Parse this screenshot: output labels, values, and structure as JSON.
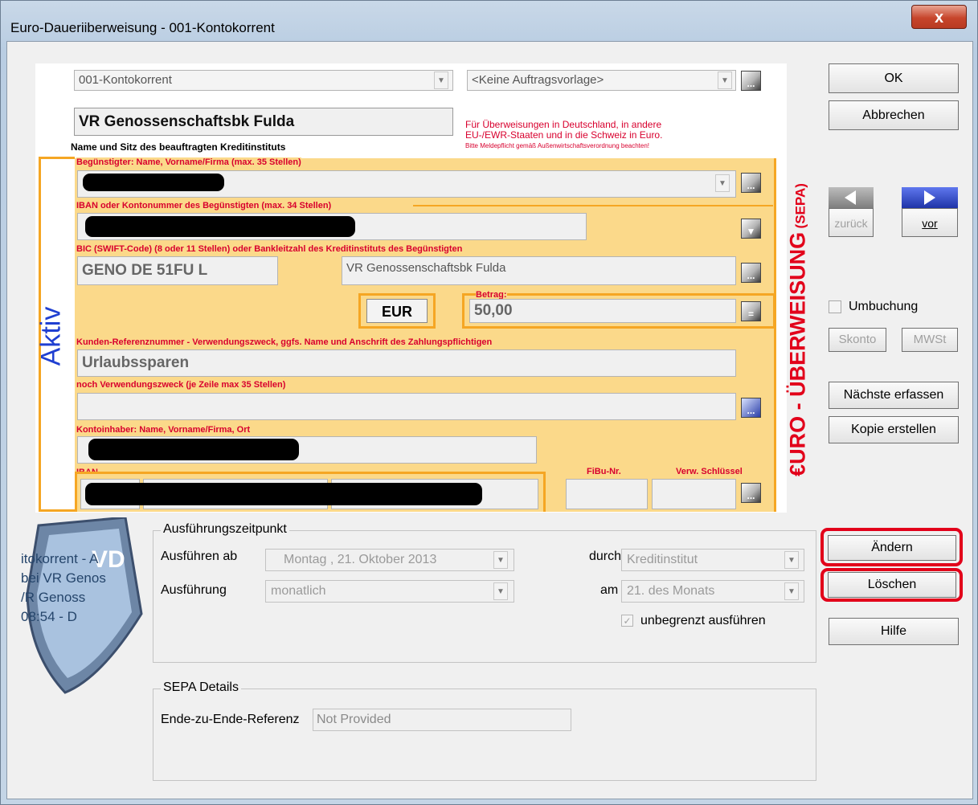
{
  "window": {
    "title": "Euro-Daueriiberweisung - 001-Kontokorrent",
    "close_label": "x"
  },
  "top": {
    "account_select": "001-Kontokorrent",
    "template_select": "<Keine Auftragsvorlage>",
    "bank_name": "VR Genossenschaftsbk Fulda",
    "bank_caption": "Name und Sitz des beauftragten Kreditinstituts",
    "notice_line1": "Für Überweisungen in Deutschland, in andere",
    "notice_line2": "EU-/EWR-Staaten und in die Schweiz in Euro.",
    "notice_line3": "Bitte Meldepflicht gemäß Außenwirtschaftsverordnung beachten!"
  },
  "form": {
    "beneficiary_label": "Begünstigter: Name, Vorname/Firma (max. 35 Stellen)",
    "iban_label": "IBAN oder Kontonummer des Begünstigten (max. 34 Stellen)",
    "bic_label": "BIC (SWIFT-Code) (8 oder 11 Stellen) oder Bankleitzahl des Kreditinstituts des Begünstigten",
    "bic_value": "GENO DE 51FU L",
    "bank_value": "VR Genossenschaftsbk Fulda",
    "amount_label": "Betrag:",
    "currency": "EUR",
    "amount": "50,00",
    "reference_label": "Kunden-Referenznummer - Verwendungszweck, ggfs. Name und Anschrift des Zahlungspflichtigen",
    "reference_value": "Urlaubssparen",
    "purpose2_label": "noch Verwendungszweck (je Zeile max 35 Stellen)",
    "purpose2_value": "",
    "holder_label": "Kontoinhaber: Name, Vorname/Firma, Ort",
    "payer_iban_label": "IBAN",
    "fibu_label": "FiBu-Nr.",
    "schluessel_label": "Verw. Schlüssel",
    "side_label_main": "€URO - ÜBERWEISUNG",
    "side_label_sepa": "(SEPA)",
    "status_label": "Aktiv"
  },
  "buttons": {
    "ok": "OK",
    "cancel": "Abbrechen",
    "back": "zurück",
    "next": "vor",
    "umbuchung": "Umbuchung",
    "skonto": "Skonto",
    "mwst": "MWSt",
    "next_entry": "Nächste erfassen",
    "copy": "Kopie erstellen",
    "change": "Ändern",
    "delete": "Löschen",
    "help": "Hilfe"
  },
  "execution": {
    "group_title": "Ausführungszeitpunkt",
    "start_label": "Ausführen ab",
    "start_value": "Montag  , 21.  Oktober  2013",
    "via_label": "durch",
    "via_value": "Kreditinstitut",
    "interval_label": "Ausführung",
    "interval_value": "monatlich",
    "day_label": "am",
    "day_value": "21. des Monats",
    "unlimited_label": "unbegrenzt ausführen"
  },
  "sepa": {
    "group_title": "SEPA Details",
    "e2e_label": "Ende-zu-Ende-Referenz",
    "e2e_value": "Not Provided"
  },
  "background_card": {
    "line1": "itokorrent - A",
    "line2": "bei VR Genos",
    "line3": "/R Genoss",
    "line4": "08:54 - D"
  },
  "colors": {
    "form_yellow": "#fbd98a",
    "form_border": "#f5a623",
    "label_red": "#d8002e",
    "highlight_red": "#e2001a"
  }
}
